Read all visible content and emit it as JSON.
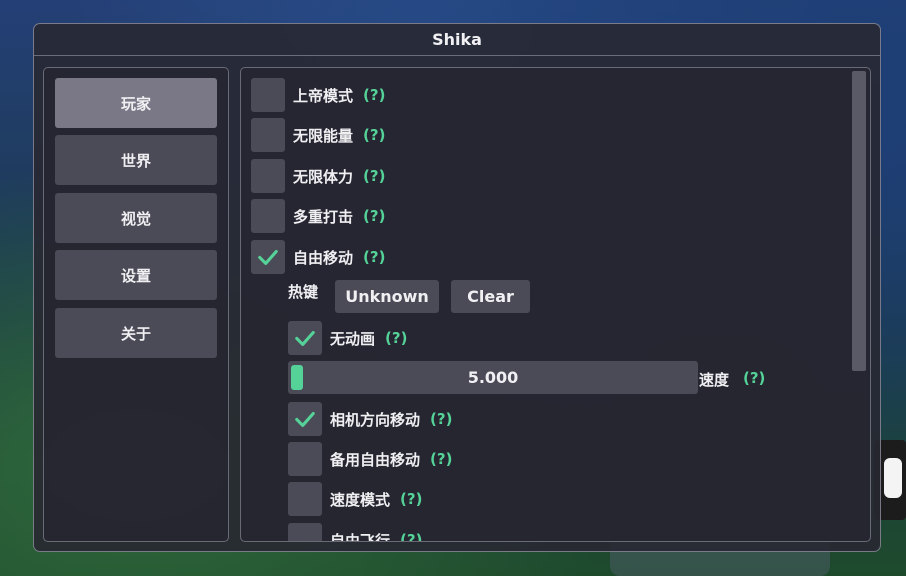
{
  "window": {
    "title": "Shika"
  },
  "sidebar": {
    "items": [
      {
        "label": "玩家",
        "active": true
      },
      {
        "label": "世界"
      },
      {
        "label": "视觉"
      },
      {
        "label": "设置"
      },
      {
        "label": "关于"
      }
    ]
  },
  "options": {
    "help_text": "(?)",
    "god_mode": {
      "label": "上帝模式",
      "checked": false
    },
    "infinite_energy": {
      "label": "无限能量",
      "checked": false
    },
    "infinite_stamina": {
      "label": "无限体力",
      "checked": false
    },
    "multi_hit": {
      "label": "多重打击",
      "checked": false
    },
    "free_move": {
      "label": "自由移动",
      "checked": true
    },
    "hotkey": {
      "label": "热键",
      "value_button": "Unknown",
      "clear_button": "Clear"
    },
    "no_animation": {
      "label": "无动画",
      "checked": true
    },
    "speed": {
      "label": "速度",
      "value": "5.000"
    },
    "camera_relative": {
      "label": "相机方向移动",
      "checked": true
    },
    "alt_free_move": {
      "label": "备用自由移动",
      "checked": false
    },
    "speed_mode": {
      "label": "速度模式",
      "checked": false
    },
    "free_fly": {
      "label": "自由飞行",
      "checked": false
    }
  },
  "colors": {
    "accent": "#55d298",
    "button": "#4b4a57",
    "active_tab": "#7a7887"
  }
}
